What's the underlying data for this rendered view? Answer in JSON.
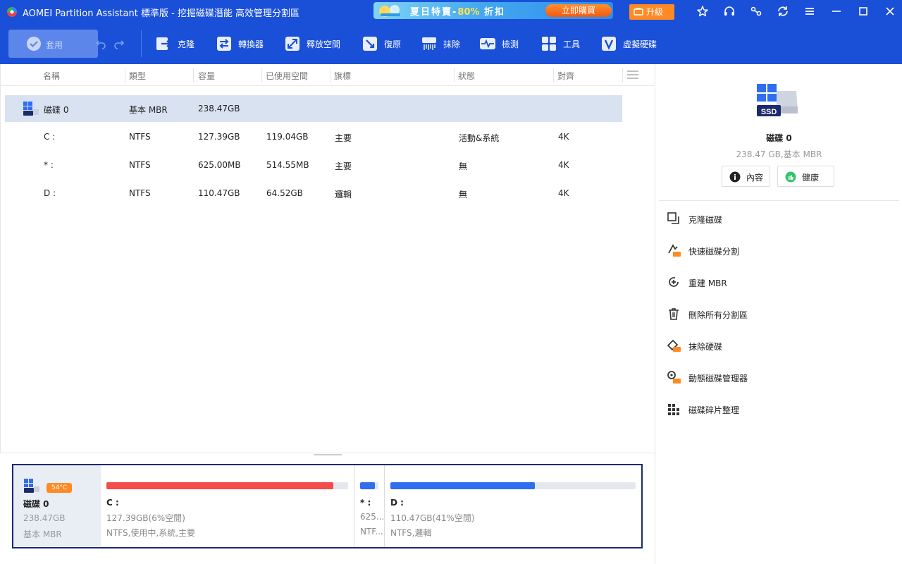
{
  "titlebar": {
    "title": "AOMEI Partition Assistant 標準版 - 挖掘磁碟潛能 高效管理分割區",
    "promo_text_a": "夏日特賣-",
    "promo_pct": "80%",
    "promo_text_b": " 折扣",
    "promo_button": "立即購買",
    "upgrade": "升級"
  },
  "toolbar": {
    "apply": "套用",
    "tools": [
      "克隆",
      "轉換器",
      "釋放空間",
      "復原",
      "抹除",
      "檢測",
      "工具",
      "虛擬硬碟"
    ]
  },
  "table": {
    "headers": [
      "名稱",
      "類型",
      "容量",
      "已使用空間",
      "旗標",
      "狀態",
      "對齊"
    ],
    "rows": [
      {
        "name": "磁碟 0",
        "type": "基本 MBR",
        "capacity": "238.47GB",
        "used": "",
        "flag": "",
        "status": "",
        "align": ""
      },
      {
        "name": "C :",
        "type": "NTFS",
        "capacity": "127.39GB",
        "used": "119.04GB",
        "flag": "主要",
        "status": "活動&系統",
        "align": "4K"
      },
      {
        "name": "* :",
        "type": "NTFS",
        "capacity": "625.00MB",
        "used": "514.55MB",
        "flag": "主要",
        "status": "無",
        "align": "4K"
      },
      {
        "name": "D :",
        "type": "NTFS",
        "capacity": "110.47GB",
        "used": "64.52GB",
        "flag": "邏輯",
        "status": "無",
        "align": "4K"
      }
    ]
  },
  "diskmap": {
    "ssd_label": "SSD",
    "temperature": "54°C",
    "disk_name": "磁碟 0",
    "disk_size": "238.47GB",
    "disk_type": "基本 MBR",
    "partitions": [
      {
        "name": "C :",
        "line1": "127.39GB(6%空閒)",
        "line2": "NTFS,使用中,系統,主要",
        "used_fraction": 0.94,
        "color": "#f44b4b"
      },
      {
        "name": "* :",
        "line1": "625...",
        "line2": "NTF...",
        "used_fraction": 0.82,
        "color": "#2f6ef0"
      },
      {
        "name": "D :",
        "line1": "110.47GB(41%空閒)",
        "line2": "NTFS,邏輯",
        "used_fraction": 0.59,
        "color": "#2f6ef0"
      }
    ]
  },
  "right": {
    "ssd_label": "SSD",
    "disk_name": "磁碟 0",
    "disk_desc": "238.47 GB,基本 MBR",
    "btn_properties": "內容",
    "btn_health": "健康",
    "operations": [
      "克隆磁碟",
      "快速磁碟分割",
      "重建 MBR",
      "刪除所有分割區",
      "抹除硬碟",
      "動態磁碟管理器",
      "磁碟碎片整理"
    ]
  }
}
